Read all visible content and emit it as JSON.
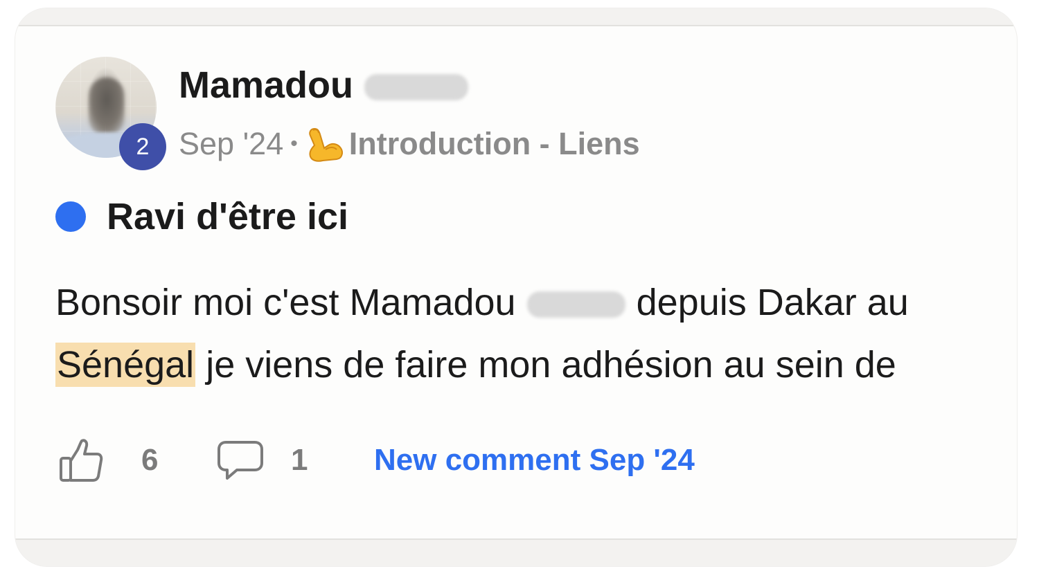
{
  "post": {
    "author": {
      "first_name": "Mamadou",
      "avatar_badge": "2"
    },
    "meta": {
      "date": "Sep '24",
      "separator": "•",
      "category_icon": "flexed-biceps-emoji",
      "category": "Introduction - Liens"
    },
    "topic": {
      "title": "Ravi d'être ici"
    },
    "excerpt": {
      "line1_before": "Bonsoir moi c'est Mamadou",
      "line1_after": "depuis Dakar au",
      "line2_highlight": "Sénégal",
      "line2_rest": " je viens de faire mon adhésion au sein de"
    },
    "actions": {
      "likes": "6",
      "comments": "1",
      "new_comment": "New comment Sep '24"
    }
  },
  "colors": {
    "accent": "#2e6ff0",
    "badge": "#3f4fa8",
    "highlight": "#f8deaf",
    "muted_text": "#8a8a8a"
  }
}
